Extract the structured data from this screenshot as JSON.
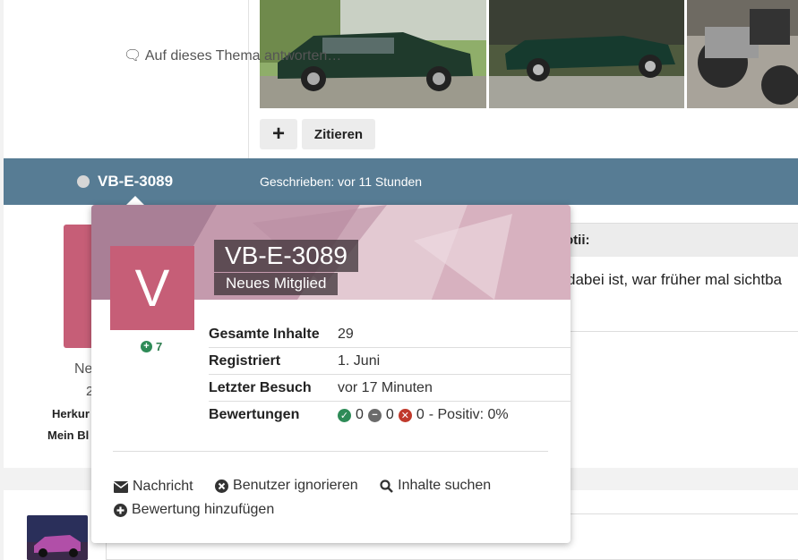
{
  "post": {
    "plus_label": "+",
    "quote_label": "Zitieren"
  },
  "author_bar": {
    "username": "VB-E-3089",
    "written": "Geschrieben: vor 11 Stunden"
  },
  "sidebar_profile": {
    "role_partial": "Ne",
    "count_partial": "2",
    "herkunft_partial": "Herkur",
    "mein_partial": "Mein Bl"
  },
  "quote": {
    "header_partial": "otii:",
    "body_partial": "dabei ist, war früher mal sichtba"
  },
  "reply": {
    "placeholder": "Auf dieses Thema antworten…"
  },
  "popup": {
    "avatar_letter": "V",
    "name": "VB-E-3089",
    "member_title": "Neues Mitglied",
    "reputation": "7",
    "stats": [
      {
        "label": "Gesamte Inhalte",
        "value": "29"
      },
      {
        "label": "Registriert",
        "value": "1. Juni"
      },
      {
        "label": "Letzter Besuch",
        "value": "vor 17 Minuten"
      }
    ],
    "ratings": {
      "label": "Bewertungen",
      "positive": "0",
      "neutral": "0",
      "negative": "0",
      "summary": "- Positiv: 0%"
    },
    "actions": {
      "message": "Nachricht",
      "ignore": "Benutzer ignorieren",
      "search": "Inhalte suchen",
      "add_rating": "Bewertung hinzufügen"
    }
  },
  "colors": {
    "author_bar": "#577c94",
    "avatar": "#c65e77",
    "positive": "#2e8b57",
    "neutral": "#6b6b6b",
    "negative": "#c0392b"
  }
}
